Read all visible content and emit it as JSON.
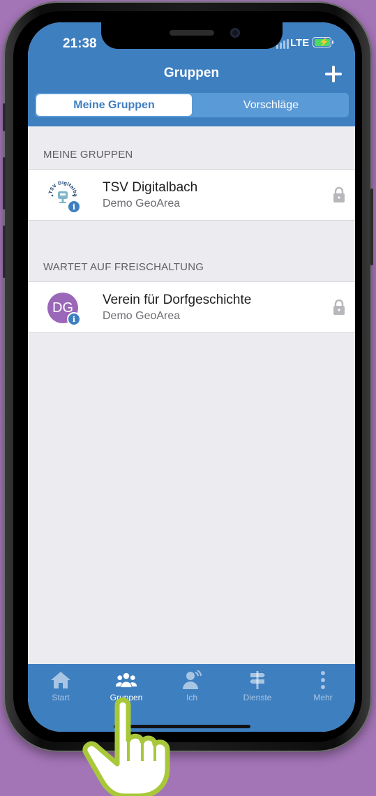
{
  "status_bar": {
    "time": "21:38",
    "network": "LTE"
  },
  "header": {
    "title": "Gruppen",
    "add_icon": "plus-icon",
    "tabs": [
      {
        "label": "Meine Gruppen",
        "active": true
      },
      {
        "label": "Vorschläge",
        "active": false
      }
    ]
  },
  "sections": [
    {
      "header": "MEINE GRUPPEN",
      "items": [
        {
          "title": "TSV Digitalbach",
          "subtitle": "Demo GeoArea",
          "avatar": "tsv-logo",
          "badge_icon": "info-icon",
          "lock_icon": "lock-icon"
        }
      ]
    },
    {
      "header": "WARTET AUF FREISCHALTUNG",
      "items": [
        {
          "title": "Verein für Dorfgeschichte",
          "subtitle": "Demo GeoArea",
          "avatar_initials": "DG",
          "badge_icon": "info-icon",
          "lock_icon": "lock-icon"
        }
      ]
    }
  ],
  "logo_text": "TSV Digitalbach",
  "tabbar": {
    "items": [
      {
        "label": "Start",
        "icon": "home-icon",
        "active": false
      },
      {
        "label": "Gruppen",
        "icon": "group-icon",
        "active": true
      },
      {
        "label": "Ich",
        "icon": "person-icon",
        "active": false
      },
      {
        "label": "Dienste",
        "icon": "signpost-icon",
        "active": false
      },
      {
        "label": "Mehr",
        "icon": "more-icon",
        "active": false
      }
    ]
  },
  "colors": {
    "background": "#a374b6",
    "brand_blue": "#3e7fc0",
    "avatar_purple": "#9b67b8",
    "pointer_green": "#a8c83a"
  },
  "overlay": {
    "pointer_icon": "tap-hand-icon"
  }
}
